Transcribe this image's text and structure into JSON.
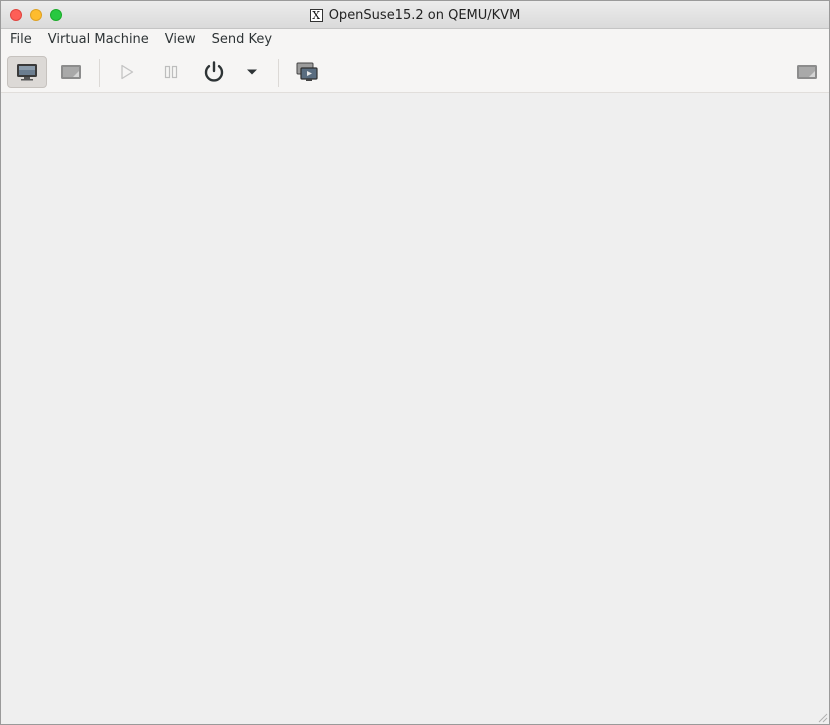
{
  "window": {
    "title": "OpenSuse15.2 on QEMU/KVM",
    "title_icon": "x11-icon"
  },
  "menubar": {
    "items": [
      {
        "label": "File"
      },
      {
        "label": "Virtual Machine"
      },
      {
        "label": "View"
      },
      {
        "label": "Send Key"
      }
    ]
  },
  "toolbar": {
    "buttons": [
      {
        "icon": "monitor-console-icon",
        "state": "active"
      },
      {
        "icon": "details-monitor-icon",
        "state": "normal"
      },
      {
        "icon": "run-icon",
        "state": "disabled"
      },
      {
        "icon": "pause-icon",
        "state": "disabled"
      },
      {
        "icon": "power-icon",
        "state": "normal"
      },
      {
        "icon": "chevron-down-icon",
        "state": "normal"
      },
      {
        "icon": "snapshots-icon",
        "state": "normal"
      },
      {
        "icon": "fullscreen-monitor-icon",
        "state": "normal"
      }
    ]
  },
  "colors": {
    "close": "#fe5f57",
    "minimize": "#febc2e",
    "maximize": "#28c840",
    "console_bg": "#efefef"
  }
}
